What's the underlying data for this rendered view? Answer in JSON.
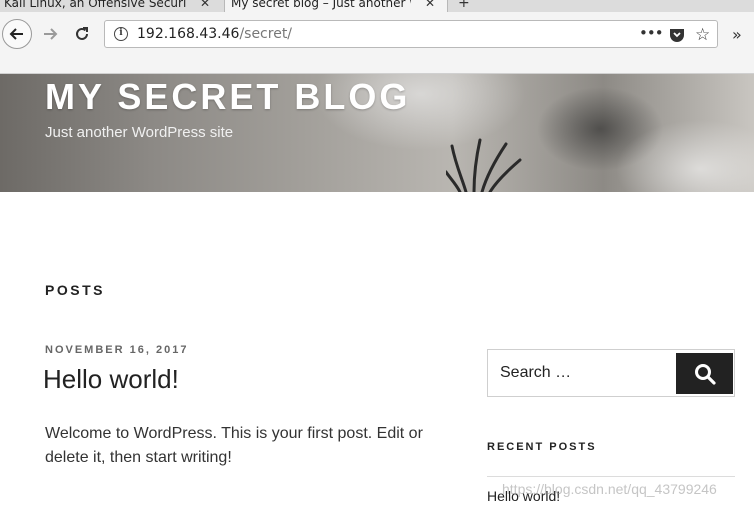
{
  "browser": {
    "tabs": [
      {
        "label": "Kali Linux, an Offensive Securi",
        "active": false
      },
      {
        "label": "My secret blog – Just another W",
        "active": true
      }
    ],
    "new_tab_symbol": "+",
    "url": {
      "host": "192.168.43.46",
      "path": "/secret/"
    },
    "icons": [
      "back-arrow-icon",
      "forward-arrow-icon",
      "reload-icon",
      "info-icon",
      "more-icon",
      "pocket-icon",
      "star-icon",
      "overflow-icon"
    ]
  },
  "site": {
    "title": "MY SECRET BLOG",
    "tagline": "Just another WordPress site"
  },
  "main": {
    "section_heading": "POSTS",
    "post": {
      "date": "NOVEMBER 16, 2017",
      "title": "Hello world!",
      "excerpt": "Welcome to WordPress. This is your first post. Edit or delete it, then start writing!"
    }
  },
  "sidebar": {
    "search_placeholder": "Search …",
    "recent_heading": "RECENT POSTS",
    "recent_posts": [
      "Hello world!"
    ]
  },
  "watermark": "https://blog.csdn.net/qq_43799246",
  "colors": {
    "accent": "#222222",
    "chrome": "#f4f4f4",
    "tab_bar": "#dcdcdc"
  }
}
